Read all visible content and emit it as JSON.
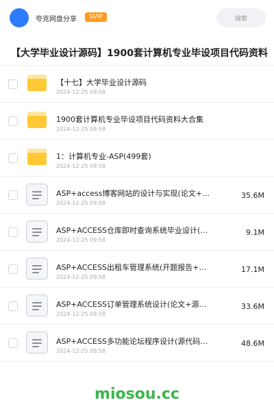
{
  "header": {
    "user_name": "夸克网盘分享",
    "vip_badge": "SVIP",
    "search_placeholder": "搜索"
  },
  "page_title": "【大学毕业设计源码】1900套计算机专业毕设项目代码资料",
  "files": [
    {
      "type": "folder",
      "name": "【十七】大学毕业设计源码",
      "date": "2024-12-25 09:58",
      "size": ""
    },
    {
      "type": "folder",
      "name": "1900套计算机专业毕设项目代码资料大合集",
      "date": "2024-12-25 09:58",
      "size": ""
    },
    {
      "type": "folder",
      "name": "1：计算机专业-ASP(499套)",
      "date": "2024-12-25 09:58",
      "size": ""
    },
    {
      "type": "file",
      "name": "ASP+access博客网站的设计与实现(论文+源…",
      "date": "2024-12-25 09:58",
      "size": "35.6M"
    },
    {
      "type": "file",
      "name": "ASP+ACCESS仓库即时查询系统毕业设计(源代…",
      "date": "2024-12-25 09:58",
      "size": "9.1M"
    },
    {
      "type": "file",
      "name": "ASP+ACCESS出租车管理系统(开题报告+源代…",
      "date": "2024-12-25 09:58",
      "size": "17.1M"
    },
    {
      "type": "file",
      "name": "ASP+ACCESS订单管理系统设计(论文+源代码…",
      "date": "2024-12-25 09:58",
      "size": "33.6M"
    },
    {
      "type": "file",
      "name": "ASP+ACCESS多功能论坛程序设计(源代码+论…",
      "date": "2024-12-25 09:58",
      "size": "48.6M"
    }
  ],
  "footer": {
    "brand": "miosou.cc"
  },
  "colors": {
    "avatar": "#2f7bff",
    "vip_badge": "#ff9a1f",
    "folder": "#ffc935",
    "brand": "#3bb54a"
  }
}
